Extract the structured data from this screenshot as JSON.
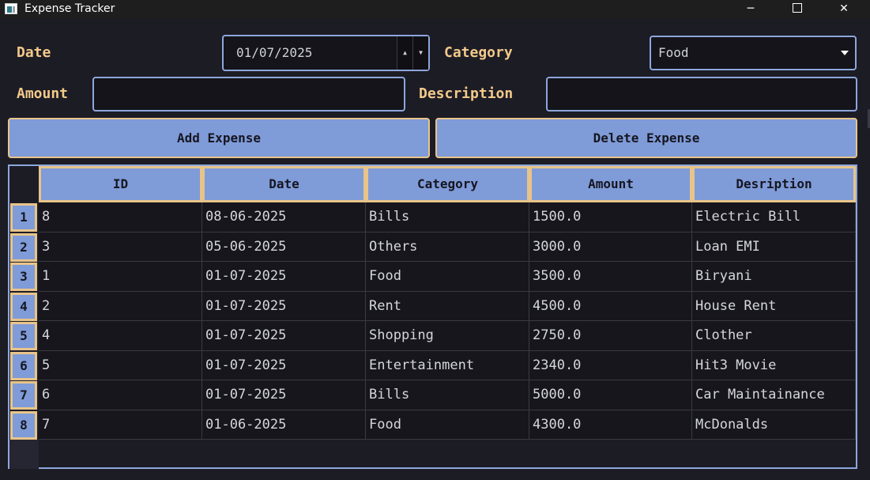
{
  "window": {
    "title": "Expense Tracker",
    "icon": "app-icon"
  },
  "controls": {
    "minimize": "─",
    "maximize": "",
    "close": "✕"
  },
  "form": {
    "date_label": "Date",
    "date_value": "01/07/2025",
    "category_label": "Category",
    "category_value": "Food",
    "amount_label": "Amount",
    "amount_value": "",
    "description_label": "Description",
    "description_value": ""
  },
  "buttons": {
    "add": "Add Expense",
    "delete": "Delete Expense"
  },
  "table": {
    "columns": [
      "ID",
      "Date",
      "Category",
      "Amount",
      "Desription"
    ],
    "row_numbers": [
      "1",
      "2",
      "3",
      "4",
      "5",
      "6",
      "7",
      "8"
    ],
    "rows": [
      [
        "8",
        "08-06-2025",
        "Bills",
        "1500.0",
        "Electric Bill"
      ],
      [
        "3",
        "05-06-2025",
        "Others",
        "3000.0",
        "Loan EMI"
      ],
      [
        "1",
        "01-07-2025",
        "Food",
        "3500.0",
        "Biryani"
      ],
      [
        "2",
        "01-07-2025",
        "Rent",
        "4500.0",
        "House Rent"
      ],
      [
        "4",
        "01-07-2025",
        "Shopping",
        "2750.0",
        "Clother"
      ],
      [
        "5",
        "01-07-2025",
        "Entertainment",
        "2340.0",
        "Hit3 Movie"
      ],
      [
        "6",
        "01-07-2025",
        "Bills",
        "5000.0",
        "Car Maintainance"
      ],
      [
        "7",
        "01-06-2025",
        "Food",
        "4300.0",
        "McDonalds"
      ]
    ]
  },
  "colors": {
    "background": "#1c1c25",
    "accent": "#7f9bd8",
    "label": "#f3c98a",
    "button_border": "#e8c48a"
  }
}
